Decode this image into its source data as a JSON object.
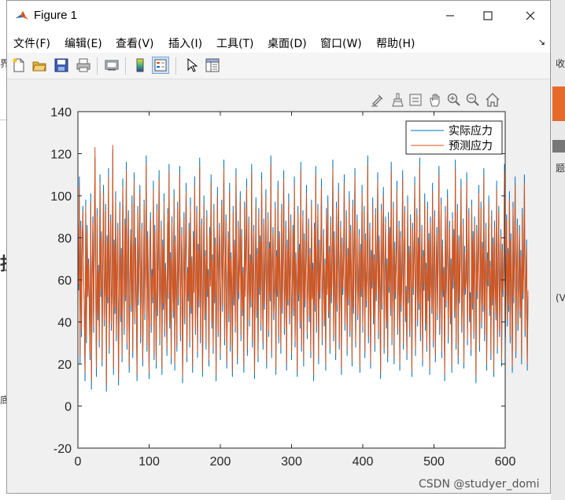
{
  "window": {
    "title": "Figure 1"
  },
  "menu": [
    {
      "label": "文件(F)"
    },
    {
      "label": "编辑(E)"
    },
    {
      "label": "查看(V)"
    },
    {
      "label": "插入(I)"
    },
    {
      "label": "工具(T)"
    },
    {
      "label": "桌面(D)"
    },
    {
      "label": "窗口(W)"
    },
    {
      "label": "帮助(H)"
    }
  ],
  "toolbar_icons": [
    "new-figure-icon",
    "open-file-icon",
    "save-icon",
    "print-icon",
    "link-plot-icon",
    "insert-colorbar-icon",
    "insert-legend-icon",
    "pointer-icon",
    "property-inspector-icon"
  ],
  "plot_toolbar_icons": [
    "brush-edit-icon",
    "data-brush-icon",
    "data-tips-icon",
    "pan-icon",
    "zoom-in-icon",
    "zoom-out-icon",
    "home-icon"
  ],
  "background_fragments": {
    "left_top": "界",
    "right_top": "收",
    "left_mid": "抈",
    "right_mid": "(V",
    "left_low": "底",
    "right_side": "题"
  },
  "watermark": "CSDN @studyer_domi",
  "colors": {
    "series1": "#0072bd",
    "series2": "#d95319",
    "background": "#f0f0f0"
  },
  "chart_data": {
    "type": "line",
    "title": "",
    "xlabel": "",
    "ylabel": "",
    "xlim": [
      0,
      600
    ],
    "ylim": [
      -20,
      140
    ],
    "xticks": [
      "0",
      "100",
      "200",
      "300",
      "400",
      "500",
      "600"
    ],
    "yticks": [
      "-20",
      "0",
      "20",
      "40",
      "60",
      "80",
      "100",
      "120",
      "140"
    ],
    "legend_position": "top-right",
    "series": [
      {
        "name": "实际应力",
        "color": "#0072bd",
        "values": [
          55,
          109,
          20,
          88,
          33,
          79,
          95,
          62,
          45,
          12,
          98,
          30,
          86,
          55,
          70,
          47,
          22,
          101,
          8,
          63,
          90,
          35,
          76,
          118,
          59,
          14,
          94,
          41,
          67,
          28,
          110,
          52,
          83,
          19,
          73,
          105,
          38,
          61,
          96,
          7,
          81,
          49,
          113,
          25,
          68,
          91,
          36,
          57,
          122,
          15,
          79,
          44,
          102,
          31,
          66,
          87,
          10,
          54,
          97,
          40,
          75,
          21,
          108,
          63,
          34,
          89,
          50,
          116,
          27,
          71,
          93,
          16,
          58,
          84,
          45,
          100,
          23,
          67,
          111,
          39,
          80,
          56,
          12,
          95,
          48,
          74,
          105,
          30,
          62,
          87,
          19,
          53,
          98,
          41,
          70,
          119,
          26,
          83,
          59,
          13,
          77,
          92,
          35,
          65,
          49,
          107,
          22,
          86,
          54,
          18,
          96,
          43,
          72,
          112,
          29,
          61,
          88,
          15,
          79,
          46,
          101,
          33,
          68,
          57,
          24,
          94,
          51,
          115,
          37,
          73,
          20,
          90,
          60,
          42,
          103,
          17,
          81,
          55,
          26,
          97,
          48,
          69,
          114,
          31,
          64,
          85,
          11,
          58,
          92,
          39,
          75,
          106,
          21,
          66,
          50,
          87,
          28,
          99,
          44,
          71,
          16,
          83,
          57,
          109,
          34,
          62,
          95,
          23,
          77,
          47,
          118,
          30,
          68,
          89,
          14,
          56,
          100,
          41,
          74,
          27,
          93,
          52,
          65,
          19,
          85,
          60,
          110,
          37,
          72,
          25,
          96,
          49,
          80,
          12,
          63,
          104,
          33,
          70,
          87,
          22,
          58,
          98,
          45,
          76,
          117,
          29,
          67,
          91,
          18,
          54,
          83,
          40,
          106,
          26,
          73,
          59,
          14,
          95,
          48,
          79,
          35,
          113,
          62,
          20,
          88,
          51,
          69,
          102,
          31,
          84,
          43,
          66,
          16,
          97,
          55,
          77,
          108,
          24,
          61,
          90,
          38,
          72,
          47,
          115,
          28,
          64,
          86,
          13,
          57,
          99,
          42,
          75,
          21,
          94,
          53,
          81,
          36,
          111,
          60,
          27,
          89,
          46,
          70,
          103,
          18,
          65,
          92,
          33,
          78,
          50,
          119,
          23,
          67,
          85,
          41,
          58,
          97,
          15,
          74,
          52,
          107,
          30,
          83,
          62,
          25,
          96,
          44,
          71,
          112,
          34,
          59,
          88,
          17,
          79,
          48,
          101,
          39,
          66,
          91,
          22,
          55,
          86,
          43,
          109,
          28,
          73,
          60,
          14,
          95,
          50,
          77,
          37,
          116,
          26,
          64,
          93,
          19,
          82,
          47,
          70,
          105,
          32,
          58,
          89,
          40,
          75,
          23,
          98,
          54,
          68,
          12,
          87,
          45,
          114,
          35,
          63,
          96,
          20,
          79,
          51,
          73,
          108,
          29,
          61,
          84,
          38,
          70,
          17,
          94,
          56,
          100,
          42,
          76,
          25,
          90,
          49,
          65,
          117,
          31,
          83,
          58,
          22,
          97,
          45,
          72,
          106,
          27,
          63,
          88,
          15,
          80,
          53,
          68,
          110,
          36,
          57,
          93,
          24,
          75,
          48,
          102,
          33,
          86,
          62,
          19,
          98,
          44,
          71,
          113,
          28,
          66,
          91,
          41,
          59,
          84,
          16,
          77,
          52,
          105,
          35,
          69,
          95,
          23,
          82,
          47,
          64,
          119,
          30,
          60,
          87,
          18,
          74,
          56,
          99,
          39,
          72,
          26,
          94,
          50,
          67,
          111,
          32,
          81,
          58,
          13,
          96,
          46,
          75,
          104,
          25,
          63,
          90,
          37,
          70,
          21,
          92,
          54,
          85,
          43,
          116,
          29,
          61,
          97,
          20,
          78,
          51,
          73,
          107,
          34,
          58,
          88,
          17,
          83,
          45,
          66,
          112,
          27,
          69,
          95,
          40,
          57,
          22,
          100,
          49,
          76,
          33,
          91,
          62,
          14,
          87,
          53,
          71,
          109,
          24,
          65,
          94,
          38,
          80,
          46,
          118,
          31,
          59,
          86,
          19,
          74,
          55,
          101,
          36,
          68,
          26,
          97,
          50,
          82,
          15,
          90,
          60,
          44,
          106,
          28,
          72,
          93,
          21,
          63,
          85,
          41,
          77,
          114,
          34,
          57,
          99,
          23,
          79,
          52,
          66,
          12,
          95,
          47,
          73,
          103,
          30,
          61,
          88,
          39,
          70,
          16,
          92,
          56,
          84,
          42,
          117,
          27,
          65,
          96,
          20,
          81,
          49,
          75,
          108,
          35,
          58,
          89,
          18,
          76,
          53,
          62,
          111,
          29,
          67,
          94,
          40,
          54,
          24,
          98,
          46,
          83,
          32,
          90,
          63,
          11,
          86,
          51,
          72,
          105,
          26,
          60,
          97,
          37,
          78,
          45,
          113,
          31,
          64,
          87,
          17,
          73,
          57,
          100,
          43,
          69,
          22,
          93,
          48,
          80,
          14,
          88,
          59,
          41,
          107,
          25,
          70,
          95,
          33,
          62,
          84,
          19,
          77,
          52,
          66,
          115,
          28,
          56,
          91,
          38,
          75,
          45,
          102,
          30,
          82,
          61,
          16,
          97,
          49,
          71,
          109,
          23,
          65,
          89,
          36,
          58,
          86,
          42,
          74,
          20,
          94,
          51,
          68,
          110,
          33,
          60,
          79,
          17,
          52
        ]
      },
      {
        "name": "预测应力",
        "color": "#d95319",
        "values": [
          58,
          104,
          24,
          85,
          36,
          76,
          92,
          60,
          48,
          16,
          95,
          33,
          83,
          52,
          68,
          50,
          25,
          97,
          12,
          60,
          87,
          38,
          73,
          123,
          56,
          18,
          90,
          44,
          64,
          31,
          106,
          55,
          80,
          22,
          70,
          101,
          41,
          58,
          93,
          10,
          78,
          52,
          109,
          28,
          65,
          88,
          39,
          54,
          124,
          18,
          76,
          47,
          98,
          34,
          63,
          84,
          13,
          51,
          94,
          43,
          72,
          24,
          104,
          60,
          37,
          86,
          53,
          112,
          30,
          68,
          90,
          19,
          55,
          81,
          48,
          96,
          26,
          64,
          107,
          42,
          77,
          53,
          15,
          92,
          51,
          71,
          101,
          33,
          59,
          84,
          22,
          50,
          95,
          44,
          67,
          115,
          29,
          80,
          56,
          16,
          74,
          89,
          38,
          62,
          52,
          103,
          25,
          83,
          51,
          21,
          93,
          46,
          69,
          108,
          32,
          58,
          85,
          18,
          76,
          49,
          97,
          36,
          65,
          54,
          27,
          91,
          54,
          111,
          40,
          70,
          23,
          87,
          57,
          45,
          99,
          20,
          78,
          52,
          29,
          94,
          51,
          66,
          110,
          34,
          61,
          82,
          14,
          55,
          89,
          42,
          72,
          102,
          24,
          63,
          53,
          84,
          31,
          95,
          47,
          68,
          19,
          80,
          54,
          105,
          37,
          59,
          92,
          26,
          74,
          50,
          114,
          33,
          65,
          86,
          17,
          53,
          96,
          44,
          71,
          30,
          90,
          55,
          62,
          22,
          82,
          57,
          106,
          40,
          69,
          28,
          93,
          52,
          77,
          15,
          60,
          100,
          36,
          67,
          84,
          25,
          55,
          95,
          48,
          73,
          113,
          32,
          64,
          88,
          21,
          51,
          80,
          43,
          102,
          29,
          70,
          56,
          17,
          92,
          51,
          76,
          38,
          109,
          59,
          23,
          85,
          54,
          66,
          98,
          34,
          81,
          46,
          63,
          19,
          94,
          52,
          74,
          104,
          27,
          58,
          87,
          41,
          69,
          50,
          111,
          31,
          61,
          83,
          16,
          54,
          95,
          45,
          72,
          24,
          91,
          56,
          78,
          39,
          107,
          57,
          30,
          86,
          49,
          67,
          99,
          21,
          62,
          89,
          36,
          75,
          53,
          115,
          26,
          64,
          82,
          44,
          55,
          94,
          18,
          71,
          55,
          103,
          33,
          80,
          59,
          28,
          93,
          47,
          68,
          108,
          37,
          56,
          85,
          20,
          76,
          51,
          97,
          42,
          63,
          88,
          25,
          52,
          83,
          46,
          105,
          31,
          70,
          57,
          17,
          92,
          53,
          74,
          40,
          112,
          29,
          61,
          90,
          22,
          79,
          50,
          67,
          101,
          35,
          55,
          86,
          43,
          72,
          26,
          95,
          51,
          65,
          15,
          84,
          48,
          110,
          38,
          60,
          93,
          23,
          76,
          54,
          70,
          104,
          32,
          58,
          81,
          41,
          67,
          20,
          91,
          53,
          96,
          45,
          73,
          28,
          87,
          52,
          62,
          113,
          34,
          80,
          55,
          25,
          94,
          48,
          69,
          102,
          30,
          60,
          85,
          18,
          77,
          56,
          65,
          106,
          39,
          54,
          90,
          27,
          72,
          51,
          98,
          36,
          83,
          59,
          22,
          95,
          47,
          68,
          109,
          31,
          63,
          88,
          44,
          56,
          81,
          19,
          74,
          55,
          101,
          38,
          66,
          92,
          26,
          79,
          50,
          61,
          115,
          33,
          57,
          84,
          21,
          71,
          59,
          95,
          42,
          69,
          29,
          91,
          53,
          64,
          107,
          35,
          78,
          55,
          16,
          93,
          49,
          72,
          100,
          28,
          60,
          87,
          40,
          67,
          24,
          89,
          57,
          82,
          46,
          112,
          32,
          58,
          94,
          23,
          75,
          54,
          70,
          103,
          37,
          55,
          85,
          20,
          80,
          48,
          63,
          108,
          30,
          66,
          92,
          43,
          54,
          25,
          96,
          52,
          73,
          36,
          88,
          59,
          17,
          84,
          56,
          68,
          105,
          27,
          62,
          91,
          41,
          77,
          49,
          114,
          34,
          56,
          83,
          22,
          71,
          58,
          97,
          39,
          65,
          29,
          94,
          53,
          79,
          18,
          87,
          57,
          47,
          102,
          31,
          69,
          90,
          24,
          60,
          82,
          44,
          74,
          110,
          37,
          54,
          96,
          26,
          76,
          55,
          63,
          15,
          92,
          50,
          70,
          99,
          33,
          58,
          85,
          42,
          67,
          19,
          89,
          59,
          81,
          45,
          113,
          30,
          62,
          93,
          23,
          78,
          52,
          72,
          104,
          38,
          55,
          86,
          21,
          73,
          56,
          59,
          107,
          32,
          64,
          91,
          43,
          51,
          27,
          95,
          49,
          80,
          35,
          87,
          60,
          14,
          83,
          54,
          69,
          101,
          29,
          57,
          94,
          40,
          75,
          48,
          109,
          34,
          61,
          84,
          20,
          70,
          60,
          96,
          46,
          66,
          25,
          90,
          51,
          77,
          17,
          85,
          56,
          44,
          103,
          28,
          67,
          92,
          36,
          59,
          81,
          22,
          74,
          55,
          63,
          111,
          31,
          53,
          88,
          41,
          72,
          48,
          98,
          33,
          79,
          58,
          19,
          94,
          52,
          68,
          105,
          26,
          62,
          86,
          39,
          55,
          83,
          45,
          71,
          23,
          91,
          54,
          65,
          106,
          36,
          57,
          76,
          20,
          55
        ]
      }
    ]
  }
}
